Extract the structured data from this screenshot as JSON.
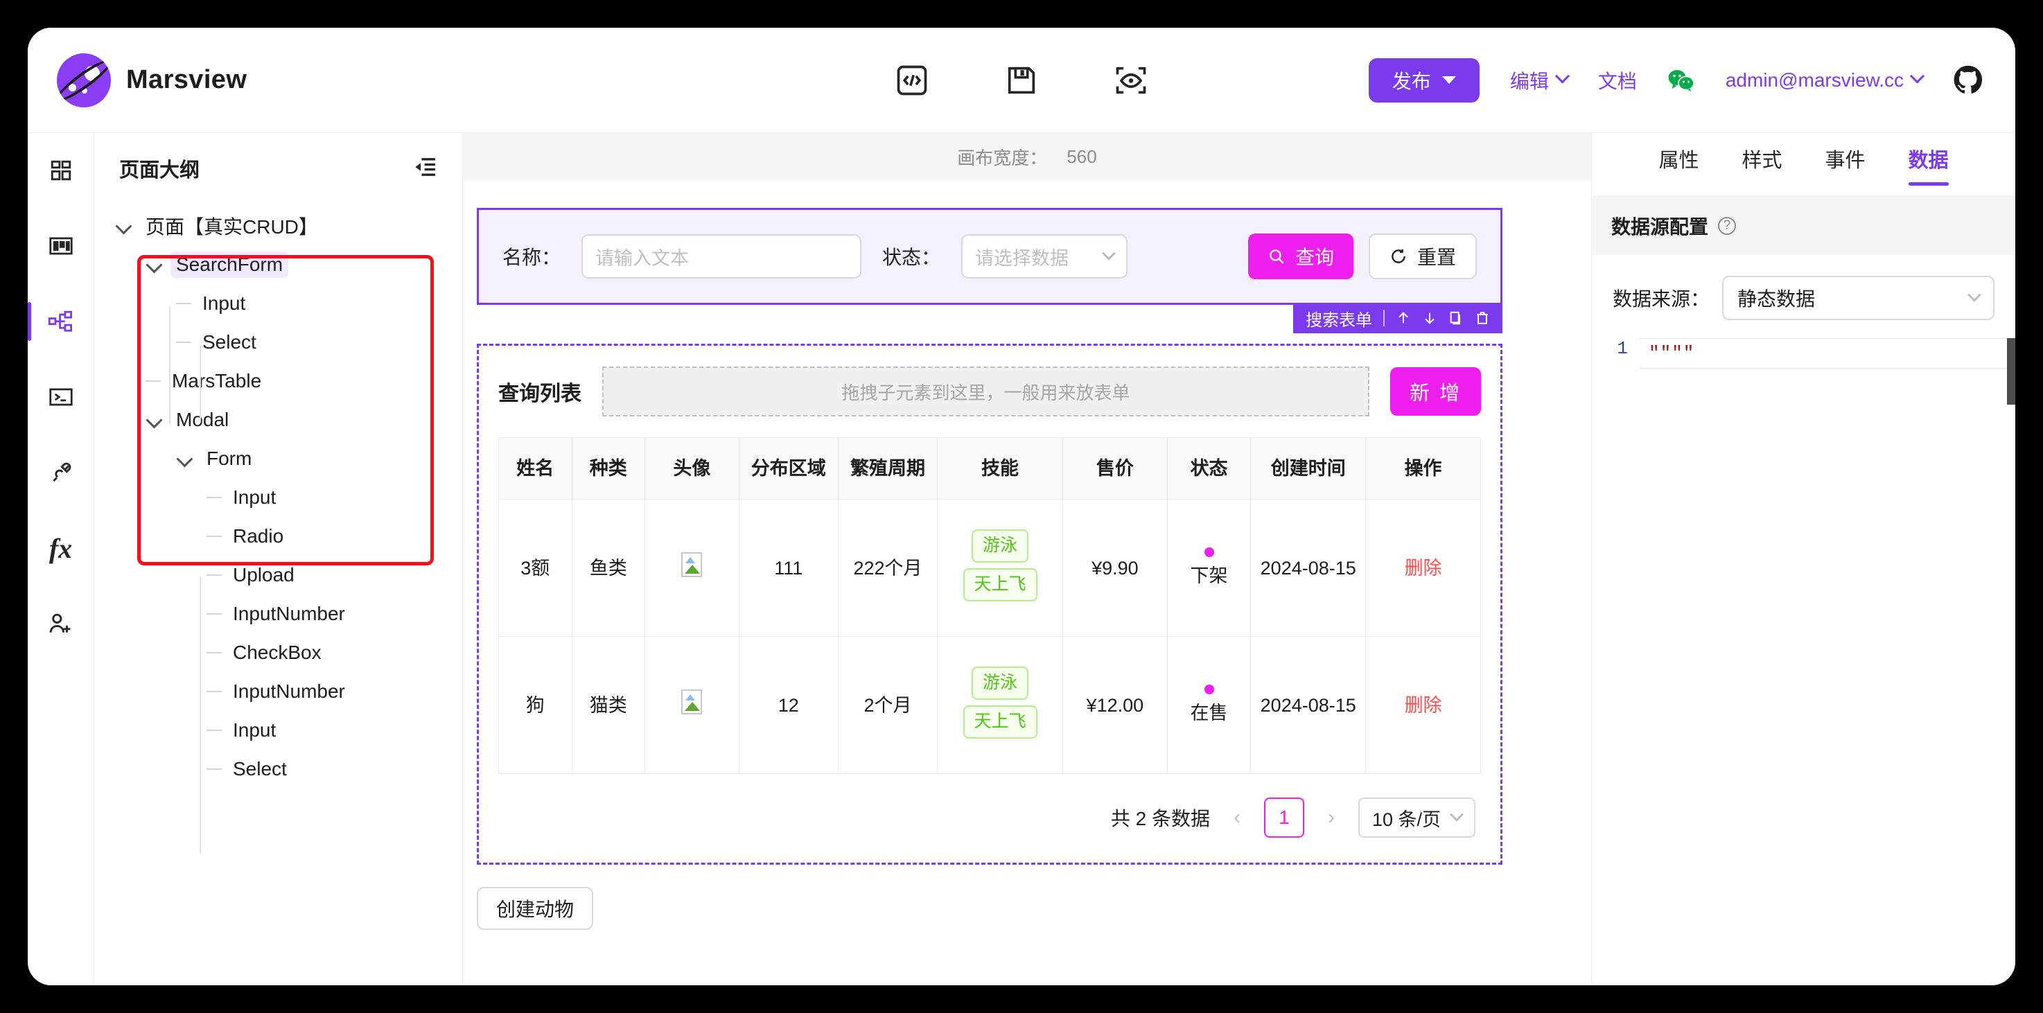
{
  "header": {
    "brand": "Marsview",
    "center_icons": [
      {
        "name": "code-icon",
        "title": "代码"
      },
      {
        "name": "save-icon",
        "title": "保存"
      },
      {
        "name": "preview-icon",
        "title": "预览"
      }
    ],
    "publish_label": "发布",
    "edit_label": "编辑",
    "docs_label": "文档",
    "account": "admin@marsview.cc"
  },
  "rail": [
    {
      "name": "components",
      "icon": "grid-icon"
    },
    {
      "name": "layout",
      "icon": "layout-icon"
    },
    {
      "name": "outline",
      "icon": "sitemap-icon",
      "active": true
    },
    {
      "name": "terminal",
      "icon": "terminal-icon"
    },
    {
      "name": "plugin",
      "icon": "plug-icon"
    },
    {
      "name": "function",
      "icon": "fx-icon"
    },
    {
      "name": "members",
      "icon": "user-add-icon"
    }
  ],
  "tree": {
    "title": "页面大纲",
    "collapse_icon": "indent-decrease-icon",
    "nodes": [
      {
        "label": "页面【真实CRUD】",
        "depth": 0,
        "arrow": "down"
      },
      {
        "label": "SearchForm",
        "depth": 1,
        "arrow": "down",
        "selected": true
      },
      {
        "label": "Input",
        "depth": 2,
        "arrow": "none"
      },
      {
        "label": "Select",
        "depth": 2,
        "arrow": "none"
      },
      {
        "label": "MarsTable",
        "depth": 1,
        "arrow": "none"
      },
      {
        "label": "Modal",
        "depth": 1,
        "arrow": "down"
      },
      {
        "label": "Form",
        "depth": 2,
        "arrow": "down"
      },
      {
        "label": "Input",
        "depth": 3,
        "arrow": "none"
      },
      {
        "label": "Radio",
        "depth": 3,
        "arrow": "none"
      },
      {
        "label": "Upload",
        "depth": 3,
        "arrow": "none"
      },
      {
        "label": "InputNumber",
        "depth": 3,
        "arrow": "none"
      },
      {
        "label": "CheckBox",
        "depth": 3,
        "arrow": "none"
      },
      {
        "label": "InputNumber",
        "depth": 3,
        "arrow": "none"
      },
      {
        "label": "Input",
        "depth": 3,
        "arrow": "none"
      },
      {
        "label": "Select",
        "depth": 3,
        "arrow": "none"
      }
    ],
    "highlight_color": "#fc0d1b"
  },
  "canvas": {
    "width_label": "画布宽度：",
    "width_value": "560",
    "search_form": {
      "name_label": "名称：",
      "name_placeholder": "请输入文本",
      "status_label": "状态：",
      "status_placeholder": "请选择数据",
      "query_label": "查询",
      "reset_label": "重置",
      "toolbar_label": "搜索表单",
      "toolbar_icons": [
        "arrow-up-icon",
        "arrow-down-icon",
        "copy-icon",
        "trash-icon"
      ]
    },
    "table": {
      "title": "查询列表",
      "drop_hint": "拖拽子元素到这里，一般用来放表单",
      "add_label": "新 增",
      "columns": [
        "姓名",
        "种类",
        "头像",
        "分布区域",
        "繁殖周期",
        "技能",
        "售价",
        "状态",
        "创建时间",
        "操作"
      ],
      "rows": [
        {
          "name": "3额",
          "kind": "鱼类",
          "avatar": "broken-image",
          "area": "111",
          "cycle": "222个月",
          "skills": [
            "游泳",
            "天上飞"
          ],
          "price": "¥9.90",
          "status": "下架",
          "created": "2024-08-15",
          "op": "删除"
        },
        {
          "name": "狗",
          "kind": "猫类",
          "avatar": "broken-image",
          "area": "12",
          "cycle": "2个月",
          "skills": [
            "游泳",
            "天上飞"
          ],
          "price": "¥12.00",
          "status": "在售",
          "created": "2024-08-15",
          "op": "删除"
        }
      ],
      "pager": {
        "total": "共 2 条数据",
        "prev": "‹",
        "current": "1",
        "next": "›",
        "page_size": "10 条/页"
      }
    },
    "create_button": "创建动物"
  },
  "right_panel": {
    "tabs": [
      {
        "label": "属性",
        "active": false
      },
      {
        "label": "样式",
        "active": false
      },
      {
        "label": "事件",
        "active": false
      },
      {
        "label": "数据",
        "active": true
      }
    ],
    "section_title": "数据源配置",
    "source_label": "数据来源：",
    "source_value": "静态数据",
    "code_line_no": "1",
    "code_line_text": "\"\"\"\""
  },
  "colors": {
    "brand_purple": "#7c3aed",
    "accent_magenta": "#ee1fee",
    "danger_red": "#ff4d4f",
    "tag_green": "#52c41a",
    "highlight_red": "#fc0d1b"
  }
}
